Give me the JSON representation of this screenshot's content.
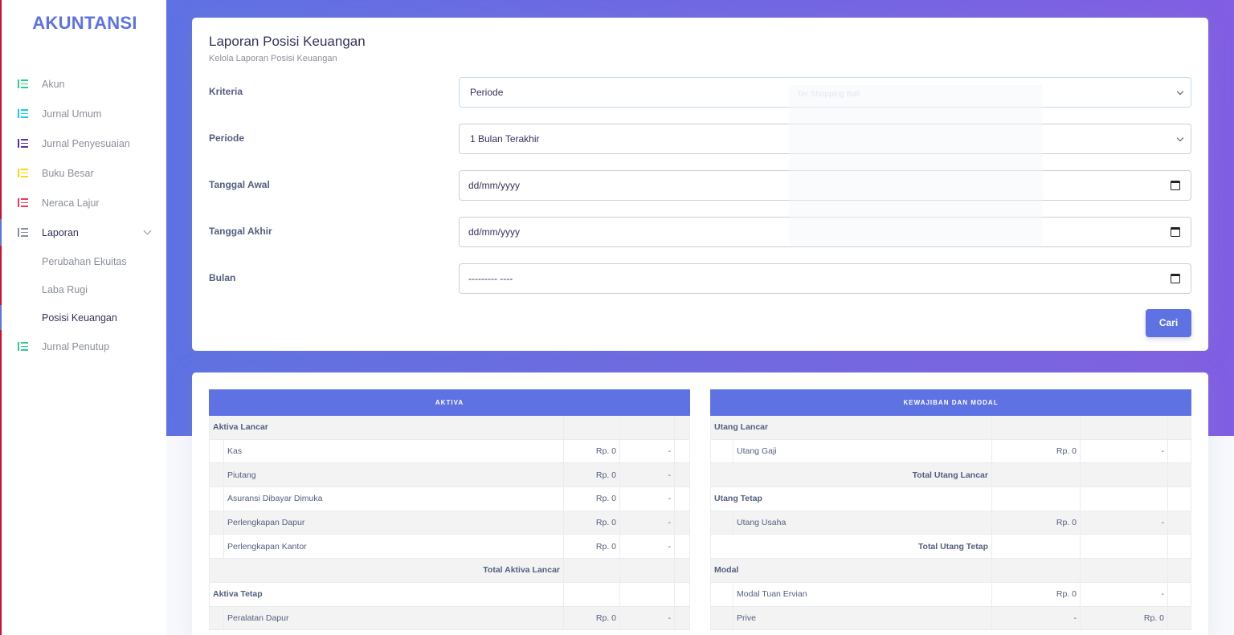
{
  "brand": "AKUNTANSI",
  "sidebar": {
    "items": [
      {
        "label": "Akun",
        "color": "#2dce89"
      },
      {
        "label": "Jurnal Umum",
        "color": "#11cdef"
      },
      {
        "label": "Jurnal Penyesuaian",
        "color": "#5e2ca5"
      },
      {
        "label": "Buku Besar",
        "color": "#ffd600"
      },
      {
        "label": "Neraca Lajur",
        "color": "#f5365c"
      },
      {
        "label": "Laporan",
        "color": "#8a8f9c"
      }
    ],
    "sub_items": [
      "Perubahan Ekuitas",
      "Laba Rugi",
      "Posisi Keuangan"
    ],
    "last_item": {
      "label": "Jurnal Penutup",
      "color": "#2dce89"
    }
  },
  "form": {
    "title": "Laporan Posisi Keuangan",
    "subtitle": "Kelola Laporan Posisi Keuangan",
    "kriteria_label": "Kriteria",
    "kriteria_value": "Periode",
    "periode_label": "Periode",
    "periode_value": "1 Bulan Terakhir",
    "tanggal_awal_label": "Tanggal Awal",
    "tanggal_awal_value": "dd/mm/yyyy",
    "tanggal_akhir_label": "Tanggal Akhir",
    "tanggal_akhir_value": "dd/mm/yyyy",
    "bulan_label": "Bulan",
    "bulan_value": "--------- ----",
    "ghost_text": "Ter Shopping Bali",
    "search_button": "Cari"
  },
  "aktiva": {
    "header": "AKTIVA",
    "rows": [
      {
        "type": "section",
        "label": "Aktiva Lancar"
      },
      {
        "type": "item",
        "label": "Kas",
        "amount": "Rp. 0",
        "other": "-"
      },
      {
        "type": "item",
        "label": "Piutang",
        "amount": "Rp. 0",
        "other": "-"
      },
      {
        "type": "item",
        "label": "Asuransi Dibayar Dimuka",
        "amount": "Rp. 0",
        "other": "-"
      },
      {
        "type": "item",
        "label": "Perlengkapan Dapur",
        "amount": "Rp. 0",
        "other": "-"
      },
      {
        "type": "item",
        "label": "Perlengkapan Kantor",
        "amount": "Rp. 0",
        "other": "-"
      },
      {
        "type": "total",
        "label": "Total Aktiva Lancar"
      },
      {
        "type": "section",
        "label": "Aktiva Tetap"
      },
      {
        "type": "item",
        "label": "Peralatan Dapur",
        "amount": "Rp. 0",
        "other": "-"
      }
    ]
  },
  "kewajiban": {
    "header": "KEWAJIBAN DAN MODAL",
    "rows": [
      {
        "type": "section",
        "label": "Utang Lancar"
      },
      {
        "type": "item",
        "label": "Utang Gaji",
        "amount": "Rp. 0",
        "other": "-"
      },
      {
        "type": "total",
        "label": "Total Utang Lancar"
      },
      {
        "type": "section",
        "label": "Utang Tetap"
      },
      {
        "type": "item",
        "label": "Utang Usaha",
        "amount": "Rp. 0",
        "other": "-"
      },
      {
        "type": "total",
        "label": "Total Utang Tetap"
      },
      {
        "type": "section",
        "label": "Modal"
      },
      {
        "type": "item",
        "label": "Modal Tuan Ervian",
        "amount": "Rp. 0",
        "other": "-"
      },
      {
        "type": "item",
        "label": "Prive",
        "amount": "-",
        "other": "Rp. 0"
      }
    ]
  }
}
